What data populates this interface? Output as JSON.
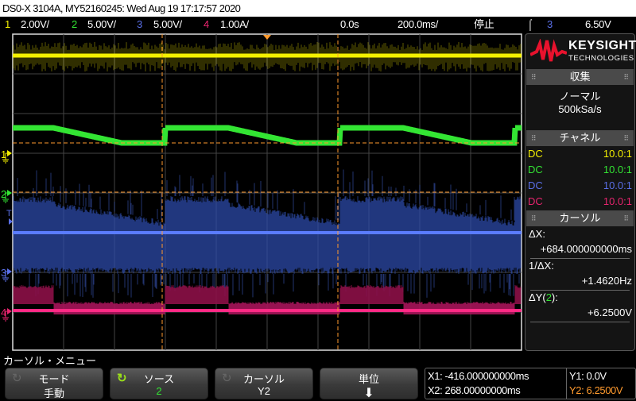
{
  "title": "DS0-X 3104A, MY52160245: Wed Aug 19 17:17:57 2020",
  "status": {
    "channels": [
      {
        "num": "1",
        "scale": "2.00V/",
        "color": "#f4f000"
      },
      {
        "num": "2",
        "scale": "5.00V/",
        "color": "#33e533"
      },
      {
        "num": "3",
        "scale": "5.00V/",
        "color": "#5a6fe8"
      },
      {
        "num": "4",
        "scale": "1.00A/",
        "color": "#e8246e"
      }
    ],
    "delay": "0.0s",
    "timebase": "200.0ms/",
    "run_state": "停止",
    "trigger_icon": "rising-edge-icon",
    "trigger_source": "3",
    "trigger_level": "6.50V"
  },
  "panel": {
    "brand": "KEYSIGHT",
    "brand_sub": "TECHNOLOGIES",
    "acquisition": {
      "header": "収集",
      "mode": "ノーマル",
      "rate": "500kSa/s"
    },
    "channel": {
      "header": "チャネル",
      "rows": [
        {
          "coupling": "DC",
          "probe": "10.0:1"
        },
        {
          "coupling": "DC",
          "probe": "10.0:1"
        },
        {
          "coupling": "DC",
          "probe": "10.0:1"
        },
        {
          "coupling": "DC",
          "probe": "10.0:1"
        }
      ]
    },
    "cursor": {
      "header": "カーソル",
      "dx_label": "ΔX:",
      "dx_value": "+684.000000000ms",
      "inv_label": "1/ΔX:",
      "inv_value": "+1.4620Hz",
      "dy_label_pre": "ΔY(",
      "dy_label_ch": "2",
      "dy_label_post": "):",
      "dy_value": "+6.2500V"
    }
  },
  "markers": {
    "ch1": "1",
    "ch2": "2",
    "ch3": "3",
    "ch4": "4",
    "trigger": "T"
  },
  "menu": {
    "title": "カーソル・メニュー",
    "softkeys": [
      {
        "label": "モード",
        "value": "手動"
      },
      {
        "label": "ソース",
        "value": "2"
      },
      {
        "label": "カーソル",
        "value": "Y2"
      },
      {
        "label": "単位",
        "value": "⬇"
      }
    ]
  },
  "readout": {
    "x1": "X1: -416.000000000ms",
    "x2": "X2: 268.00000000ms",
    "y1": "Y1: 0.0V",
    "y2": "Y2: 6.2500V"
  },
  "colors": {
    "cursor": "#ff9a2e",
    "accent_orange": "#ff9a2e"
  }
}
